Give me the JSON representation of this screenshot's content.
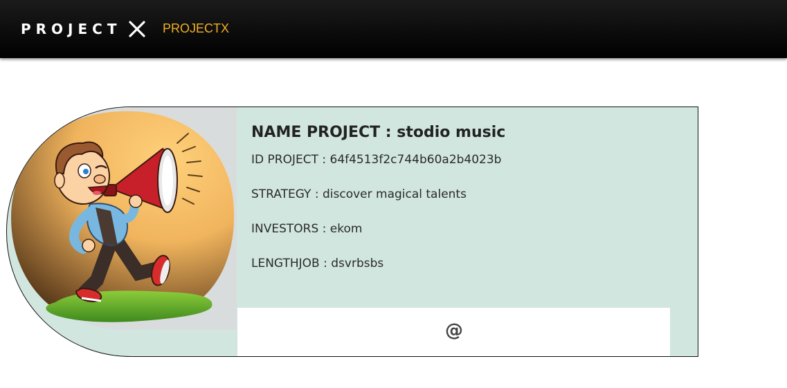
{
  "navbar": {
    "brand_text": "PROJECT",
    "brand_icon": "x-mark-icon",
    "link_label": "PROJECTX",
    "link_color": "#f2b123",
    "background": "#000000"
  },
  "project_card": {
    "background": "#d1e6df",
    "image_icon": "megaphone-man-illustration",
    "title": "NAME PROJECT : stodio music",
    "fields": {
      "id": "ID PROJECT : 64f4513f2c744b60a2b4023b",
      "strategy": "STRATEGY : discover magical talents",
      "investors": "INVESTORS : ekom",
      "lengthjob": "LENGTHJOB : dsvrbsbs"
    },
    "footer": {
      "icon": "at-sign-icon",
      "icon_glyph": "@"
    }
  }
}
